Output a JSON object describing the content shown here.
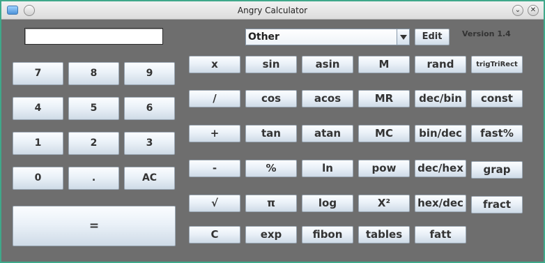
{
  "window": {
    "title": "Angry Calculator",
    "minimize_glyph": "⌄",
    "close_glyph": "✕"
  },
  "display": {
    "value": ""
  },
  "mode_select": {
    "selected": "Other",
    "edit_label": "Edit"
  },
  "version": "Version 1.4",
  "keypad": {
    "seven": "7",
    "eight": "8",
    "nine": "9",
    "four": "4",
    "five": "5",
    "six": "6",
    "one": "1",
    "two": "2",
    "three": "3",
    "zero": "0",
    "dot": ".",
    "clear_all": "AC",
    "equals": "="
  },
  "functions": {
    "multiply": "x",
    "divide": "/",
    "plus": "+",
    "minus": "-",
    "sqrt": "√",
    "clear": "C",
    "sin": "sin",
    "cos": "cos",
    "tan": "tan",
    "percent": "%",
    "pi": "π",
    "exp": "exp",
    "asin": "asin",
    "acos": "acos",
    "atan": "atan",
    "ln": "ln",
    "log": "log",
    "fibon": "fibon",
    "mem": "M",
    "mem_recall": "MR",
    "mem_clear": "MC",
    "pow": "pow",
    "square": "X²",
    "tables": "tables",
    "rand": "rand",
    "dec_bin": "dec/bin",
    "bin_dec": "bin/dec",
    "dec_hex": "dec/hex",
    "hex_dec": "hex/dec",
    "fatt": "fatt",
    "trig_tri_rect": "trigTriRect",
    "const": "const",
    "fast_percent": "fast%",
    "graph": "grap",
    "fract": "fract"
  }
}
